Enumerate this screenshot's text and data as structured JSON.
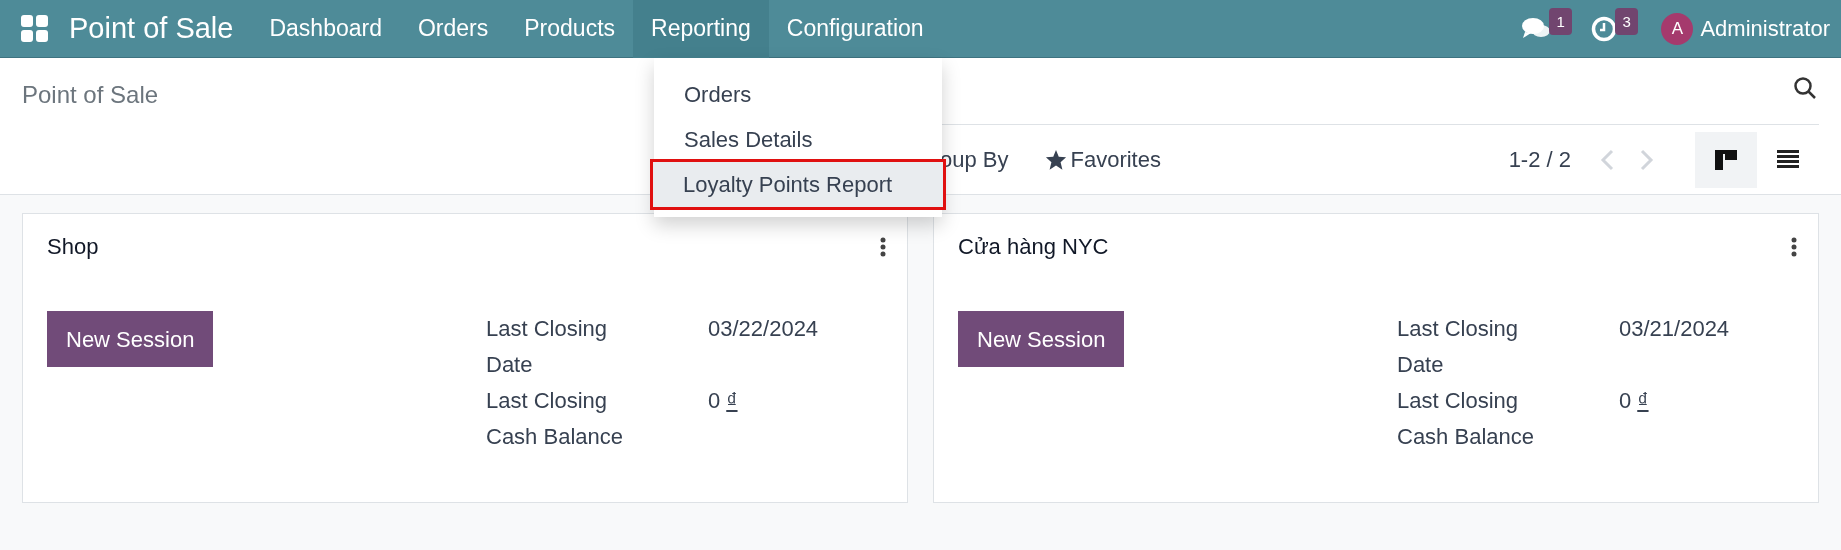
{
  "navbar": {
    "app_name": "Point of Sale",
    "menu": [
      {
        "label": "Dashboard",
        "selected": false
      },
      {
        "label": "Orders",
        "selected": false
      },
      {
        "label": "Products",
        "selected": false
      },
      {
        "label": "Reporting",
        "selected": true
      },
      {
        "label": "Configuration",
        "selected": false
      }
    ],
    "messages_badge": "1",
    "activities_badge": "3",
    "user": {
      "initial": "A",
      "name": "Administrator"
    }
  },
  "reporting_menu": [
    {
      "label": "Orders",
      "selected": false
    },
    {
      "label": "Sales Details",
      "selected": false
    },
    {
      "label": "Loyalty Points Report",
      "selected": true
    }
  ],
  "control_panel": {
    "title": "Point of Sale",
    "group_by": "oup By",
    "favorites": "Favorites",
    "pager": "1-2 / 2",
    "prev_disabled": true,
    "next_disabled": true,
    "views": [
      {
        "kind": "kanban",
        "selected": true
      },
      {
        "kind": "list",
        "selected": false
      }
    ]
  },
  "cards": [
    {
      "name": "Shop",
      "button": "New Session",
      "fields": [
        {
          "label": "Last Closing Date",
          "value": "03/22/2024"
        },
        {
          "label": "Last Closing Cash Balance",
          "value": "0",
          "currency": "₫"
        }
      ]
    },
    {
      "name": "Cửa hàng NYC",
      "button": "New Session",
      "fields": [
        {
          "label": "Last Closing Date",
          "value": "03/21/2024"
        },
        {
          "label": "Last Closing Cash Balance",
          "value": "0",
          "currency": "₫"
        }
      ]
    }
  ]
}
